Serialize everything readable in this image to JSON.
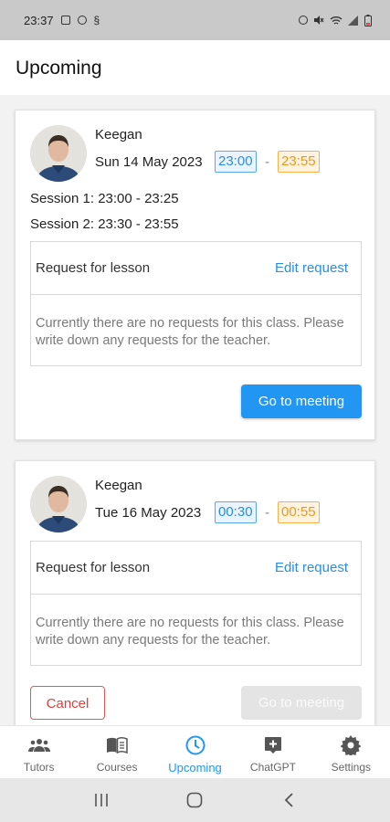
{
  "status_bar": {
    "time": "23:37",
    "left_icons": [
      "image-icon",
      "messenger-icon",
      "sync-icon"
    ],
    "right_icons": [
      "alarm-icon",
      "mute-icon",
      "wifi-icon",
      "signal-icon",
      "battery-icon"
    ]
  },
  "header": {
    "title": "Upcoming"
  },
  "lessons": [
    {
      "tutor": "Keegan",
      "date": "Sun 14 May 2023",
      "start": "23:00",
      "end": "23:55",
      "sessions": [
        "Session 1: 23:00 - 23:25",
        "Session 2: 23:30 - 23:55"
      ],
      "request_title": "Request for lesson",
      "edit_label": "Edit request",
      "request_text": "Currently there are no requests for this class. Please write down any requests for the teacher.",
      "meeting_label": "Go to meeting",
      "meeting_enabled": true
    },
    {
      "tutor": "Keegan",
      "date": "Tue 16 May 2023",
      "start": "00:30",
      "end": "00:55",
      "request_title": "Request for lesson",
      "edit_label": "Edit request",
      "request_text": "Currently there are no requests for this class. Please write down any requests for the teacher.",
      "cancel_label": "Cancel",
      "meeting_label": "Go to meeting",
      "meeting_enabled": false
    }
  ],
  "bottom_nav": {
    "items": [
      {
        "label": "Tutors",
        "icon": "people-icon"
      },
      {
        "label": "Courses",
        "icon": "book-icon"
      },
      {
        "label": "Upcoming",
        "icon": "clock-icon",
        "active": true
      },
      {
        "label": "ChatGPT",
        "icon": "chat-plus-icon"
      },
      {
        "label": "Settings",
        "icon": "gear-icon"
      }
    ]
  },
  "colors": {
    "accent": "#2196f3",
    "start_chip": "#2a8ee0",
    "end_chip": "#e69a1d",
    "cancel": "#d9423f"
  },
  "system_nav": [
    "recents-icon",
    "home-icon",
    "back-icon"
  ]
}
